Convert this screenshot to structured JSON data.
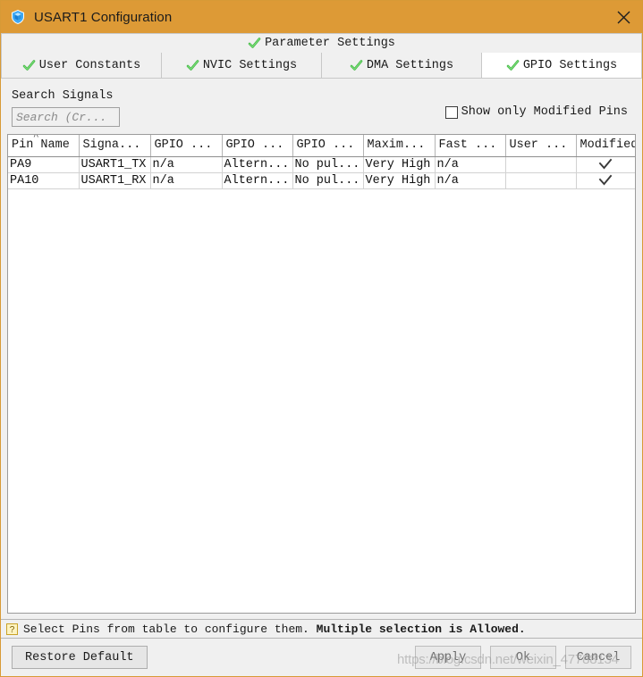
{
  "window": {
    "title": "USART1 Configuration",
    "title_icon": "shield-icon",
    "close_icon": "close-icon",
    "titlebar_color": "#dd9a36"
  },
  "tabs": {
    "row1": [
      {
        "label": "Parameter Settings",
        "icon": "green-check-icon",
        "active": false
      }
    ],
    "row2": [
      {
        "label": "User Constants",
        "icon": "green-check-icon",
        "active": false
      },
      {
        "label": "NVIC Settings",
        "icon": "green-check-icon",
        "active": false
      },
      {
        "label": "DMA Settings",
        "icon": "green-check-icon",
        "active": false
      },
      {
        "label": "GPIO Settings",
        "icon": "green-check-icon",
        "active": true
      }
    ]
  },
  "search": {
    "label": "Search Signals",
    "placeholder": "Search (Cr...",
    "value": ""
  },
  "modified_pins_checkbox": {
    "label": "Show only Modified Pins",
    "checked": false
  },
  "table": {
    "sort_column": "Pin Name",
    "sort_caret": "^",
    "headers": [
      "Pin Name",
      "Signa...",
      "GPIO ...",
      "GPIO ...",
      "GPIO ...",
      "Maxim...",
      "Fast ...",
      "User ...",
      "Modified"
    ],
    "rows": [
      {
        "pin_name": "PA9",
        "signal": "USART1_TX",
        "gpio_1": "n/a",
        "gpio_2": "Altern...",
        "gpio_3": "No pul...",
        "maximum": "Very High",
        "fast": "n/a",
        "user": "",
        "modified": true
      },
      {
        "pin_name": "PA10",
        "signal": "USART1_RX",
        "gpio_1": "n/a",
        "gpio_2": "Altern...",
        "gpio_3": "No pul...",
        "maximum": "Very High",
        "fast": "n/a",
        "user": "",
        "modified": true
      }
    ]
  },
  "statusbar": {
    "icon": "help-question-icon",
    "text_normal": "Select Pins from table to configure them. ",
    "text_bold": "Multiple selection is Allowed."
  },
  "footer": {
    "restore_default": "Restore Default",
    "apply": "Apply",
    "ok": "Ok",
    "cancel": "Cancel"
  },
  "watermark": {
    "text": "https://blog.csdn.net/weixin_47788134"
  }
}
